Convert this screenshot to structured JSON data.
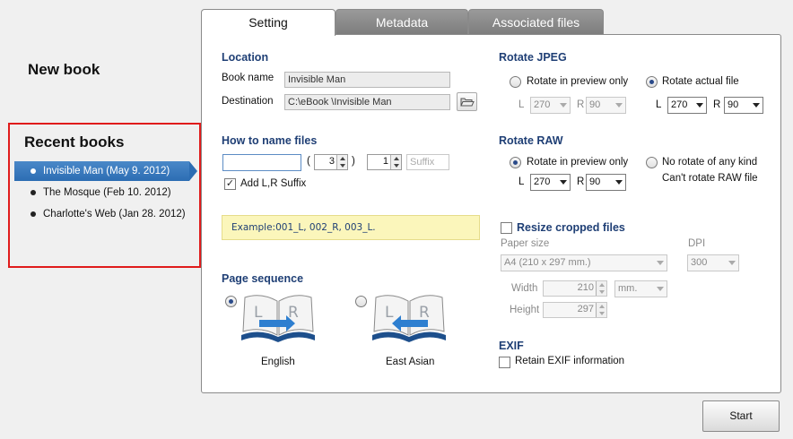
{
  "left_pane": {
    "new_book_label": "New book",
    "recent_title": "Recent books",
    "recent_items": [
      {
        "label": "Invisible Man (May 9. 2012)",
        "selected": true
      },
      {
        "label": "The Mosque (Feb 10. 2012)",
        "selected": false
      },
      {
        "label": "Charlotte's Web (Jan 28. 2012)",
        "selected": false
      }
    ]
  },
  "tabs": [
    {
      "label": "Setting",
      "active": true
    },
    {
      "label": "Metadata",
      "active": false
    },
    {
      "label": "Associated files",
      "active": false
    }
  ],
  "location": {
    "title": "Location",
    "book_name_label": "Book name",
    "book_name_value": "Invisible Man",
    "destination_label": "Destination",
    "destination_value": "C:\\eBook \\Invisible Man"
  },
  "naming": {
    "title": "How to name files",
    "prefix_value": "",
    "paren_open": "(",
    "paren_close": ")",
    "digits_value": "3",
    "start_value": "1",
    "suffix_placeholder": "Suffix",
    "add_lr_label": "Add L,R Suffix",
    "add_lr_checked": true,
    "example_text": "Example:001_L, 002_R, 003_L."
  },
  "page_sequence": {
    "title": "Page sequence",
    "options": [
      {
        "label": "English",
        "selected": true
      },
      {
        "label": "East Asian",
        "selected": false
      }
    ],
    "book_letters": {
      "left": "L",
      "right": "R"
    }
  },
  "rotate_jpeg": {
    "title": "Rotate JPEG",
    "preview_label": "Rotate in preview only",
    "actual_label": "Rotate actual file",
    "selected": "actual",
    "preview_l": "270",
    "preview_r": "90",
    "actual_l": "270",
    "actual_r": "90",
    "l_label": "L",
    "r_label": "R"
  },
  "rotate_raw": {
    "title": "Rotate RAW",
    "preview_label": "Rotate in preview only",
    "none_label": "No rotate of any kind",
    "none_note": "Can't rotate RAW file",
    "selected": "preview",
    "l_value": "270",
    "r_value": "90",
    "l_label": "L",
    "r_label": "R"
  },
  "resize": {
    "title": "Resize cropped files",
    "checked": false,
    "paper_size_label": "Paper size",
    "paper_size_value": "A4 (210 x 297 mm.)",
    "dpi_label": "DPI",
    "dpi_value": "300",
    "width_label": "Width",
    "width_value": "210",
    "unit_value": "mm.",
    "height_label": "Height",
    "height_value": "297"
  },
  "exif": {
    "title": "EXIF",
    "retain_label": "Retain EXIF information",
    "checked": false
  },
  "start_label": "Start",
  "colors": {
    "section_title": "#1f3f75",
    "selection_blue": "#2c6db3",
    "highlight_border": "#e01b1b",
    "example_bg": "#fbf6bb"
  }
}
